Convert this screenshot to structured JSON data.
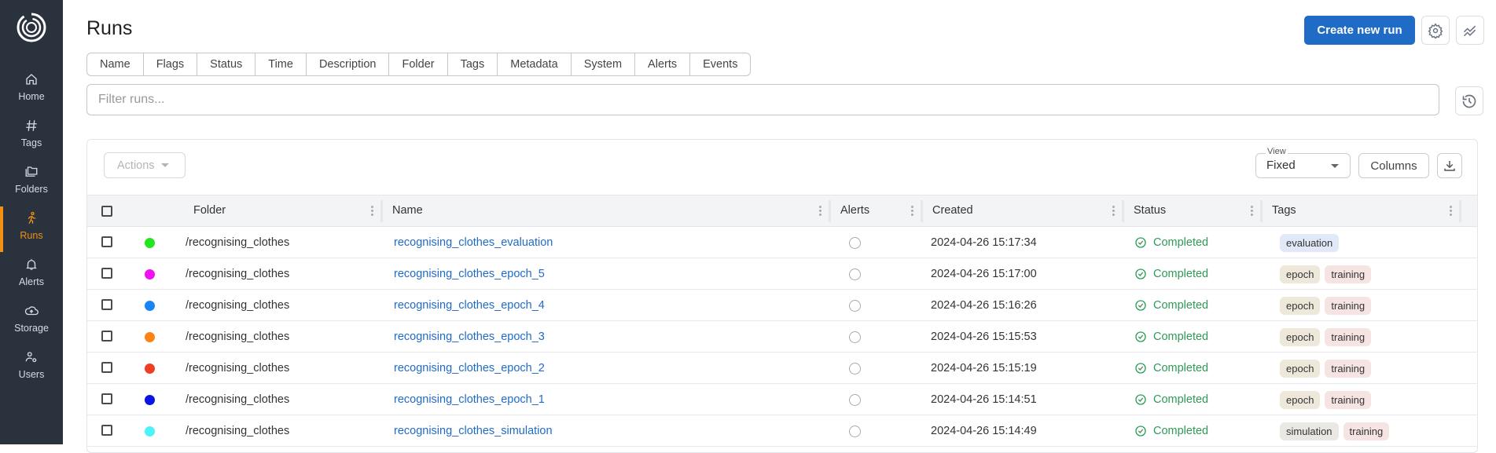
{
  "sidebar": {
    "logo": "swirl-logo",
    "items": [
      {
        "label": "Home",
        "icon": "home-icon",
        "active": false
      },
      {
        "label": "Tags",
        "icon": "hash-icon",
        "active": false
      },
      {
        "label": "Folders",
        "icon": "folders-icon",
        "active": false
      },
      {
        "label": "Runs",
        "icon": "running-person-icon",
        "active": true
      },
      {
        "label": "Alerts",
        "icon": "bell-icon",
        "active": false
      },
      {
        "label": "Storage",
        "icon": "cloud-upload-icon",
        "active": false
      },
      {
        "label": "Users",
        "icon": "users-gear-icon",
        "active": false
      }
    ]
  },
  "header": {
    "title": "Runs",
    "create_button": "Create new run",
    "settings_icon": "gear-icon",
    "compare_icon": "chart-line-icon"
  },
  "tabs": [
    "Name",
    "Flags",
    "Status",
    "Time",
    "Description",
    "Folder",
    "Tags",
    "Metadata",
    "System",
    "Alerts",
    "Events"
  ],
  "filter": {
    "placeholder": "Filter runs...",
    "value": "",
    "history_icon": "history-icon"
  },
  "toolbar": {
    "actions_label": "Actions",
    "view_legend": "View",
    "view_value": "Fixed",
    "columns_label": "Columns",
    "download_icon": "download-icon"
  },
  "table": {
    "columns": [
      "Folder",
      "Name",
      "Alerts",
      "Created",
      "Status",
      "Tags"
    ],
    "rows": [
      {
        "color": "#22e622",
        "folder": "/recognising_clothes",
        "name": "recognising_clothes_evaluation",
        "created": "2024-04-26 15:17:34",
        "status": "Completed",
        "tags": [
          "evaluation"
        ]
      },
      {
        "color": "#f010f0",
        "folder": "/recognising_clothes",
        "name": "recognising_clothes_epoch_5",
        "created": "2024-04-26 15:17:00",
        "status": "Completed",
        "tags": [
          "epoch",
          "training"
        ]
      },
      {
        "color": "#1b84f5",
        "folder": "/recognising_clothes",
        "name": "recognising_clothes_epoch_4",
        "created": "2024-04-26 15:16:26",
        "status": "Completed",
        "tags": [
          "epoch",
          "training"
        ]
      },
      {
        "color": "#fb8414",
        "folder": "/recognising_clothes",
        "name": "recognising_clothes_epoch_3",
        "created": "2024-04-26 15:15:53",
        "status": "Completed",
        "tags": [
          "epoch",
          "training"
        ]
      },
      {
        "color": "#ef3e26",
        "folder": "/recognising_clothes",
        "name": "recognising_clothes_epoch_2",
        "created": "2024-04-26 15:15:19",
        "status": "Completed",
        "tags": [
          "epoch",
          "training"
        ]
      },
      {
        "color": "#0a14e6",
        "folder": "/recognising_clothes",
        "name": "recognising_clothes_epoch_1",
        "created": "2024-04-26 15:14:51",
        "status": "Completed",
        "tags": [
          "epoch",
          "training"
        ]
      },
      {
        "color": "#4cf3f7",
        "folder": "/recognising_clothes",
        "name": "recognising_clothes_simulation",
        "created": "2024-04-26 15:14:49",
        "status": "Completed",
        "tags": [
          "simulation",
          "training"
        ]
      }
    ]
  },
  "tag_colors": {
    "evaluation": "#e1e8f7",
    "epoch": "#ede8da",
    "training": "#f5e4e2",
    "simulation": "#e9e8e2"
  },
  "colors": {
    "accent": "#1f6bc6",
    "active_nav": "#f29111",
    "sidebar_bg": "#29323d",
    "status_completed": "#2e9a57"
  }
}
